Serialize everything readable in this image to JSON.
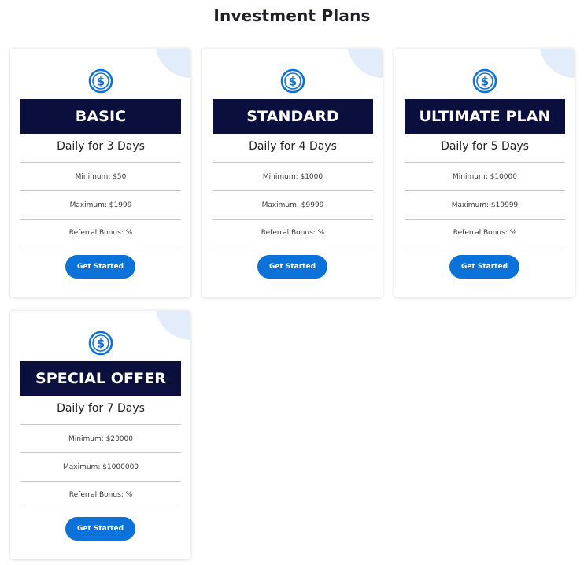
{
  "page": {
    "title": "Investment Plans"
  },
  "colors": {
    "plan_header_bg": "#0a0f3d",
    "button_bg": "#0b72d9",
    "icon_color": "#0b72d9",
    "corner_decoration": "#e3ecfb"
  },
  "plans": [
    {
      "icon": "dollar-circle-icon",
      "name": "BASIC",
      "duration": "Daily for 3 Days",
      "minimum": "Minimum: $50",
      "maximum": "Maximum: $1999",
      "referral": "Referral Bonus: %",
      "button_label": "Get Started"
    },
    {
      "icon": "dollar-circle-icon",
      "name": "STANDARD",
      "duration": "Daily for 4 Days",
      "minimum": "Minimum: $1000",
      "maximum": "Maximum: $9999",
      "referral": "Referral Bonus: %",
      "button_label": "Get Started"
    },
    {
      "icon": "dollar-circle-icon",
      "name": "ULTIMATE PLAN",
      "duration": "Daily for 5 Days",
      "minimum": "Minimum: $10000",
      "maximum": "Maximum: $19999",
      "referral": "Referral Bonus: %",
      "button_label": "Get Started"
    },
    {
      "icon": "dollar-circle-icon",
      "name": "SPECIAL OFFER",
      "duration": "Daily for 7 Days",
      "minimum": "Minimum: $20000",
      "maximum": "Maximum: $1000000",
      "referral": "Referral Bonus: %",
      "button_label": "Get Started"
    }
  ]
}
